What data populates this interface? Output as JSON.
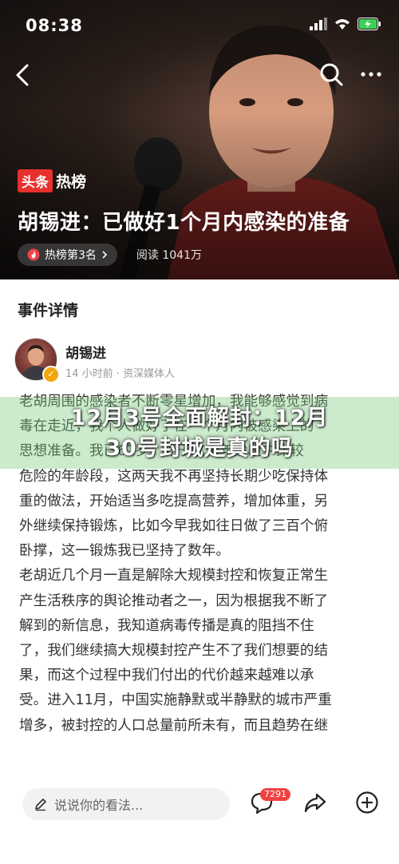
{
  "status_bar": {
    "time": "08:38"
  },
  "hero": {
    "brand_left": "头条",
    "brand_right": "热榜",
    "headline": "胡锡进：已做好1个月内感染的准备",
    "rank_label": "热榜第3名",
    "reads": "阅读 1041万"
  },
  "section": {
    "title": "事件详情"
  },
  "author": {
    "name": "胡锡进",
    "meta": "14 小时前 · 资深媒体人"
  },
  "article_lines": [
    "老胡周围的感染者不断零星增加，我能够感觉到病",
    "毒在走近，我个人做好了在一个月内被感染上的",
    "思想准备。我已62岁，处于这个年龄段中比较",
    "危险的年龄段，这两天我不再坚持长期少吃保持体",
    "重的做法，开始适当多吃提高营养，增加体重，另",
    "外继续保持锻炼，比如今早我如往日做了三百个俯",
    "卧撑，这一锻炼我已坚持了数年。",
    "老胡近几个月一直是解除大规模封控和恢复正常生",
    "产生活秩序的舆论推动者之一，因为根据我不断了",
    "解到的新信息，我知道病毒传播是真的阻挡不住",
    "了，我们继续搞大规模封控产生不了我们想要的结",
    "果，而这个过程中我们付出的代价越来越难以承",
    "受。进入11月，中国实施静默或半静默的城市严重",
    "增多，被封控的人口总量前所未有，而且趋势在继"
  ],
  "overlay": {
    "line1": "12月3号全面解封：12月",
    "line2": "30号封城是真的吗"
  },
  "bottom_bar": {
    "comment_placeholder": "说说你的看法...",
    "comment_count": "7291"
  }
}
